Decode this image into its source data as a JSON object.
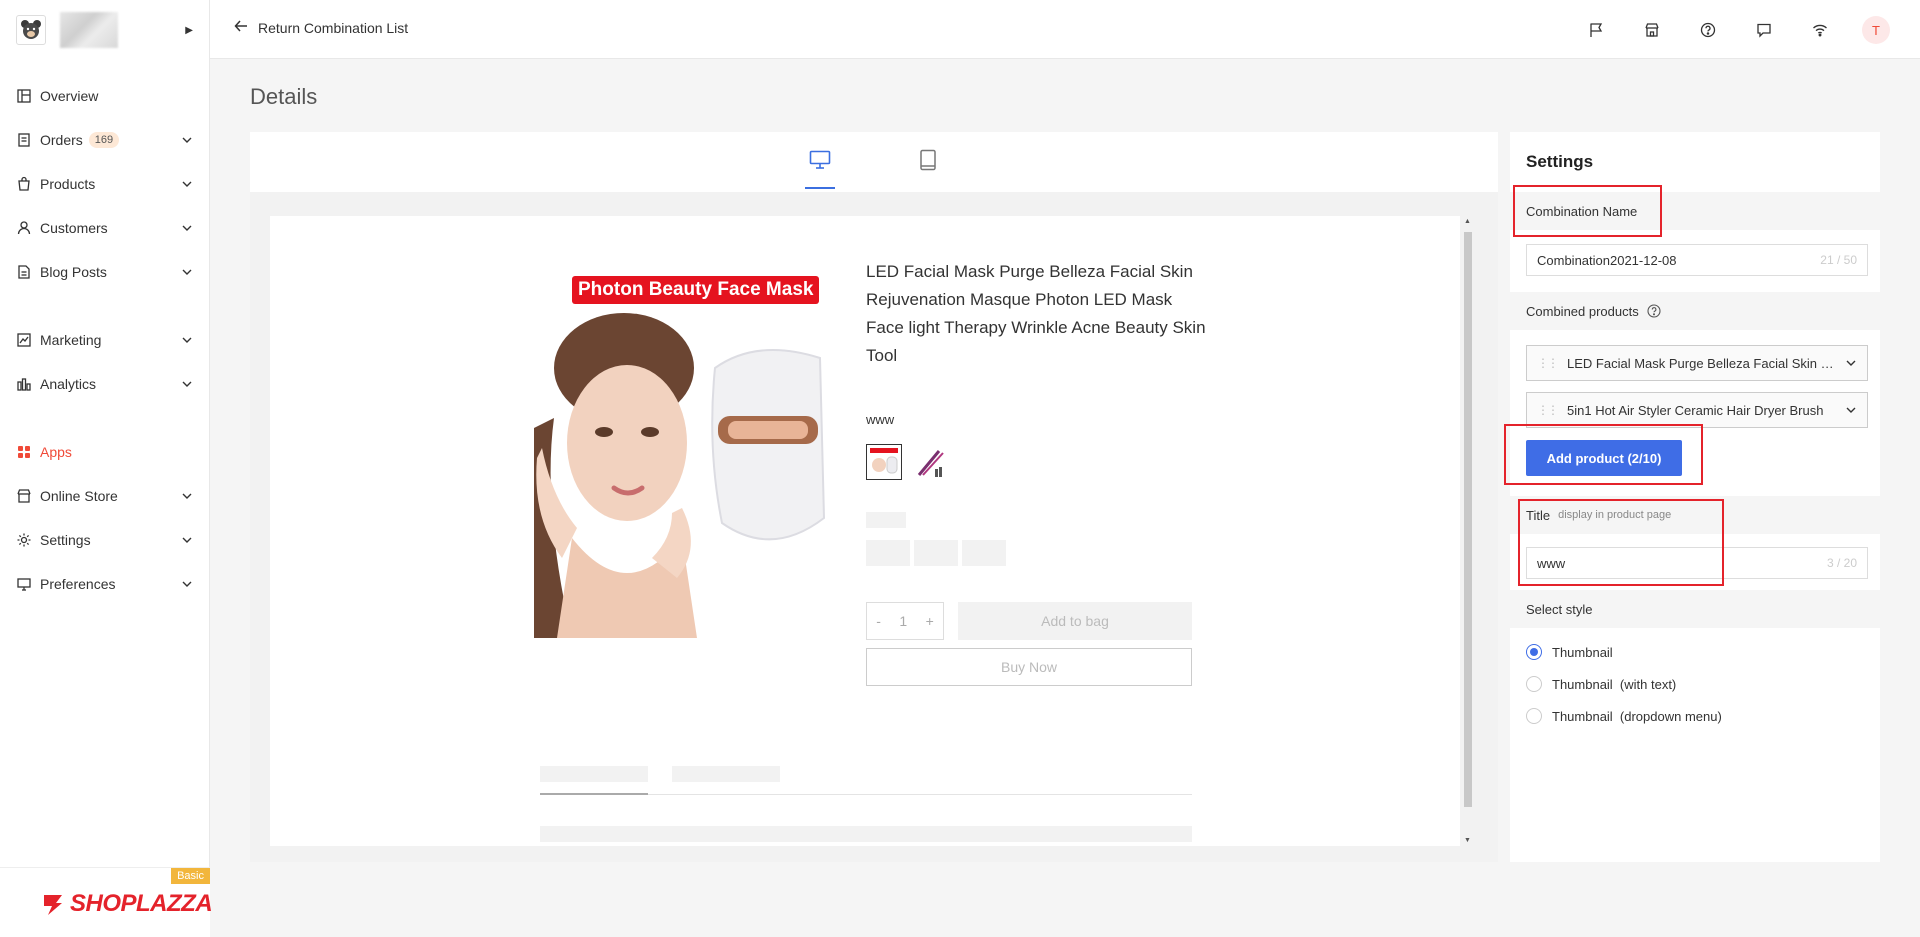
{
  "sidebar": {
    "items": [
      {
        "label": "Overview",
        "icon": "overview-icon"
      },
      {
        "label": "Orders",
        "icon": "orders-icon",
        "badge": "169"
      },
      {
        "label": "Products",
        "icon": "products-icon"
      },
      {
        "label": "Customers",
        "icon": "customers-icon"
      },
      {
        "label": "Blog Posts",
        "icon": "blog-icon"
      },
      {
        "label": "Marketing",
        "icon": "marketing-icon"
      },
      {
        "label": "Analytics",
        "icon": "analytics-icon"
      },
      {
        "label": "Apps",
        "icon": "apps-icon",
        "active": true
      },
      {
        "label": "Online Store",
        "icon": "store-icon"
      },
      {
        "label": "Settings",
        "icon": "settings-icon"
      },
      {
        "label": "Preferences",
        "icon": "preferences-icon"
      }
    ],
    "plan_tag": "Basic",
    "logo_text": "SHOPLAZZA"
  },
  "topbar": {
    "back_label": "Return Combination List",
    "avatar_letter": "T"
  },
  "page": {
    "title": "Details"
  },
  "preview": {
    "image_banner": "Photon Beauty Face Mask",
    "product_title": "LED Facial Mask Purge Belleza Facial Skin Rejuvenation Masque Photon LED Mask Face light Therapy Wrinkle Acne Beauty Skin Tool",
    "option_label": "www",
    "qty_minus": "-",
    "qty_value": "1",
    "qty_plus": "+",
    "add_to_bag": "Add to bag",
    "buy_now": "Buy Now"
  },
  "settings": {
    "heading": "Settings",
    "combination_name_label": "Combination Name",
    "combination_name_value": "Combination2021-12-08",
    "combination_name_counter": "21 / 50",
    "combined_products_label": "Combined products",
    "products": [
      "LED Facial Mask Purge Belleza Facial Skin Rejuvenation Masque",
      "5in1 Hot Air Styler Ceramic Hair Dryer Brush"
    ],
    "add_product_label": "Add product (2/10)",
    "title_label": "Title",
    "title_hint": "display in product page",
    "title_value": "www",
    "title_counter": "3 / 20",
    "select_style_label": "Select style",
    "styles": [
      "Thumbnail",
      "Thumbnail  (with text)",
      "Thumbnail  (dropdown menu)"
    ],
    "selected_style_index": 0
  },
  "colors": {
    "accent": "#3f6de6",
    "highlight": "#e4232b",
    "active_nav": "#f04a38"
  }
}
